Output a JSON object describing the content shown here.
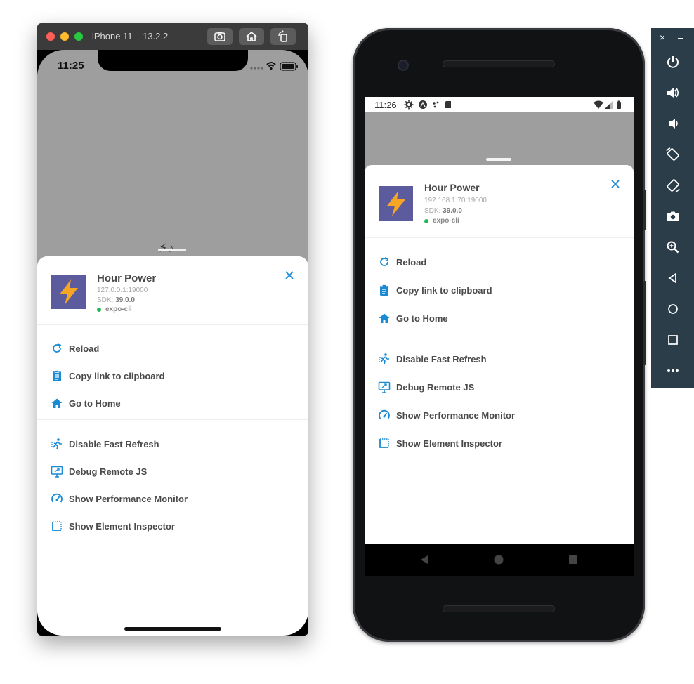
{
  "ios": {
    "window_title": "iPhone 11 – 13.2.2",
    "status_time": "11:25",
    "app": {
      "name": "Hour Power",
      "host": "127.0.0.1:19000",
      "sdk_label": "SDK:",
      "sdk_version": "39.0.0",
      "cli": "expo-cli"
    },
    "menu": [
      {
        "label": "Reload",
        "icon": "reload-icon"
      },
      {
        "label": "Copy link to clipboard",
        "icon": "clipboard-icon"
      },
      {
        "label": "Go to Home",
        "icon": "home-icon"
      },
      {
        "label": "Disable Fast Refresh",
        "icon": "running-person-icon"
      },
      {
        "label": "Debug Remote JS",
        "icon": "remote-debug-icon"
      },
      {
        "label": "Show Performance Monitor",
        "icon": "speedometer-icon"
      },
      {
        "label": "Show Element Inspector",
        "icon": "inspector-icon"
      }
    ]
  },
  "android": {
    "status_time": "11:26",
    "app": {
      "name": "Hour Power",
      "host": "192.168.1.70:19000",
      "sdk_label": "SDK:",
      "sdk_version": "39.0.0",
      "cli": "expo-cli"
    },
    "menu": [
      {
        "label": "Reload",
        "icon": "reload-icon"
      },
      {
        "label": "Copy link to clipboard",
        "icon": "clipboard-icon"
      },
      {
        "label": "Go to Home",
        "icon": "home-icon"
      },
      {
        "label": "Disable Fast Refresh",
        "icon": "running-person-icon"
      },
      {
        "label": "Debug Remote JS",
        "icon": "remote-debug-icon"
      },
      {
        "label": "Show Performance Monitor",
        "icon": "speedometer-icon"
      },
      {
        "label": "Show Element Inspector",
        "icon": "inspector-icon"
      }
    ]
  },
  "emulator_toolbar": {
    "close_glyph": "×",
    "minimize_glyph": "–",
    "buttons": [
      "power-icon",
      "volume-up-icon",
      "volume-down-icon",
      "rotate-left-icon",
      "rotate-right-icon",
      "camera-icon",
      "zoom-icon",
      "back-icon",
      "home-circle-icon",
      "overview-icon",
      "more-icon"
    ]
  },
  "colors": {
    "accent": "#1a8ad4",
    "app_icon_bg": "#5b5b9d",
    "bolt": "#f6a623",
    "online": "#1db954",
    "toolbar_bg": "#2b3d49"
  }
}
